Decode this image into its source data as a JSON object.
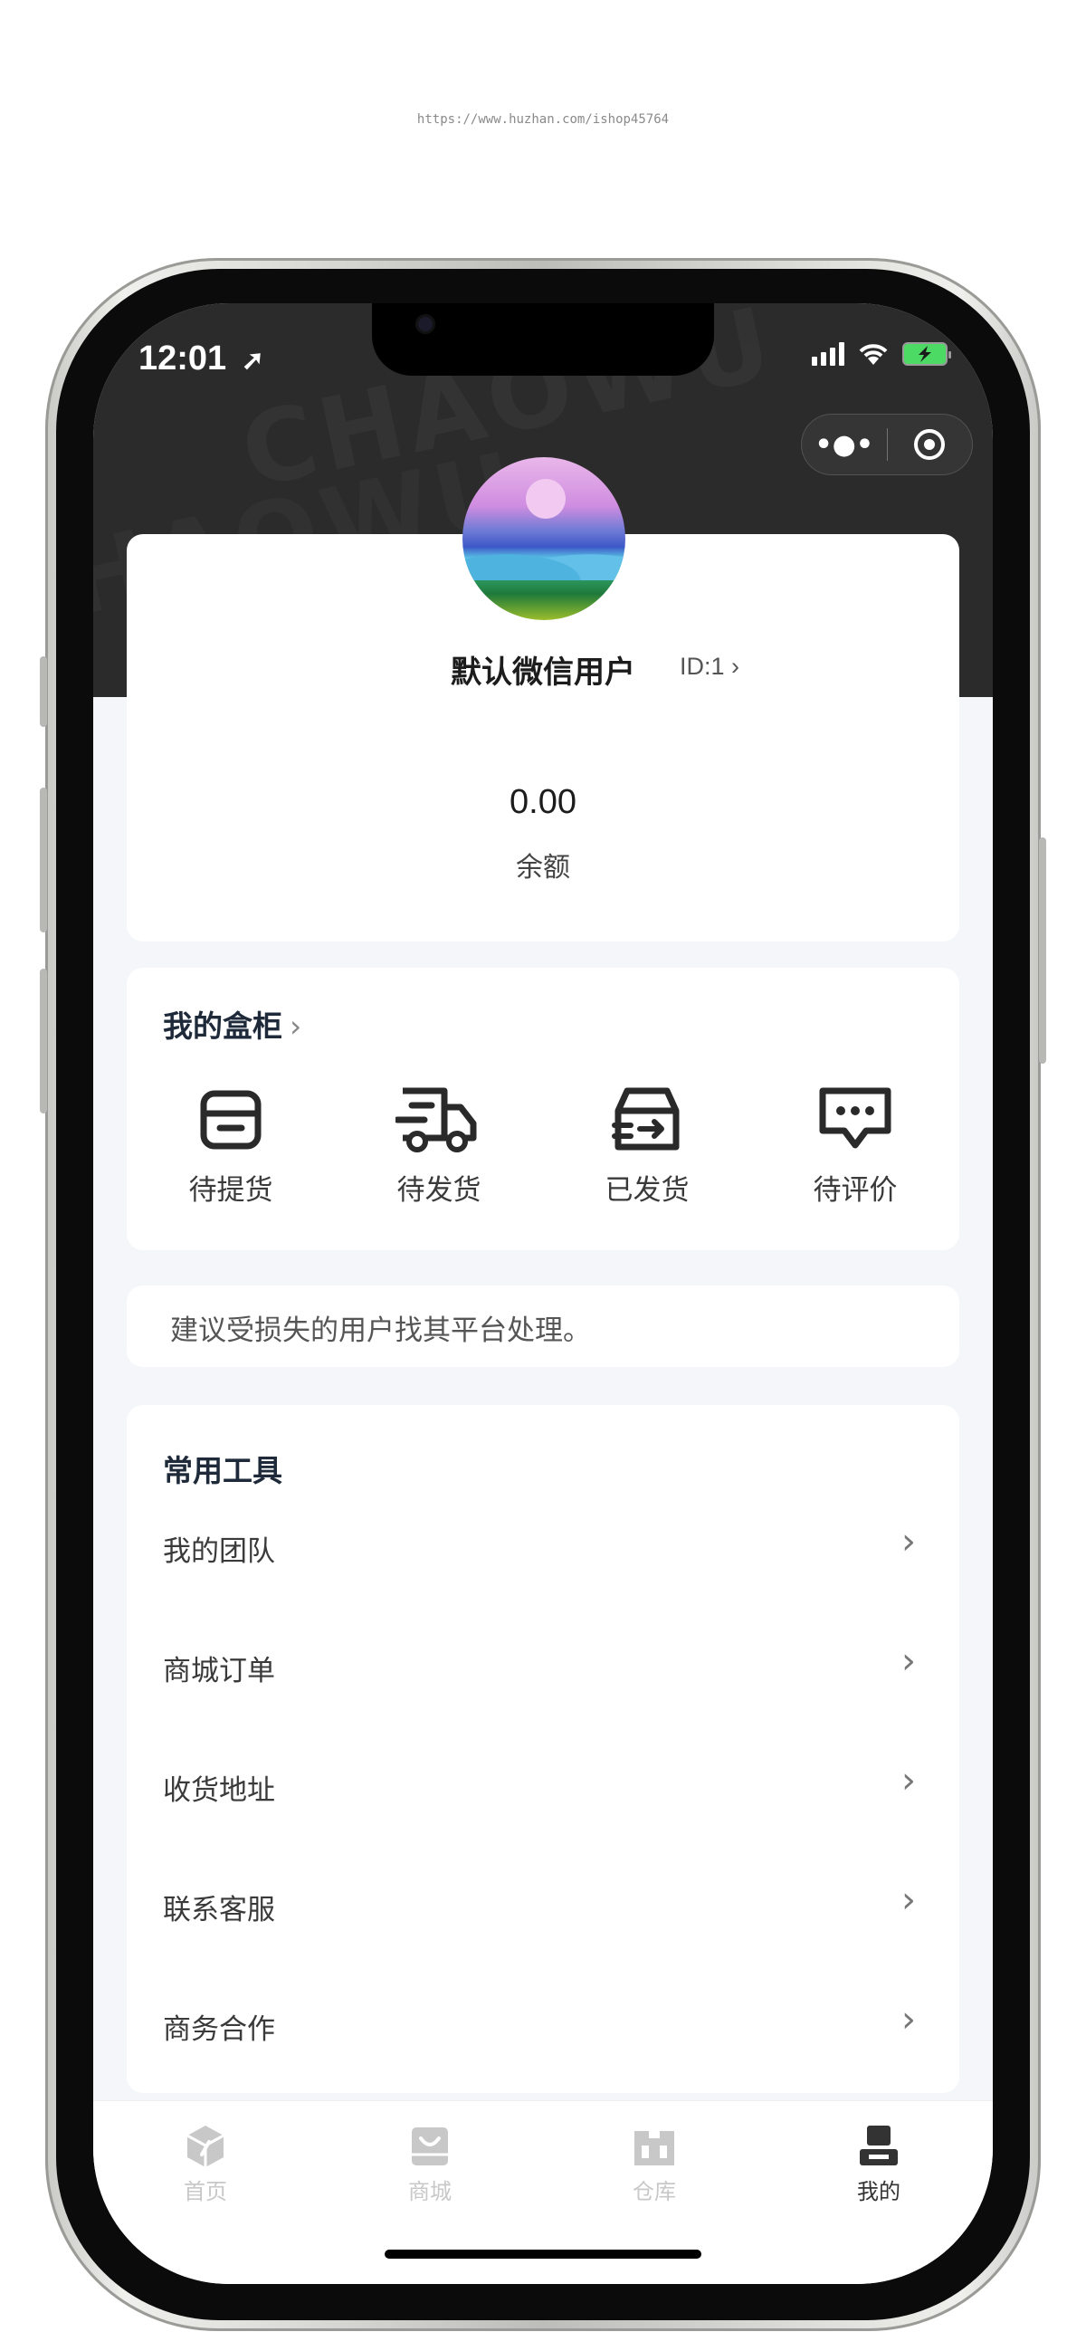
{
  "watermark_url": "https://www.huzhan.com/ishop45764",
  "status_bar": {
    "time": "12:01"
  },
  "header_watermark": "CHAOWU",
  "capsule": {
    "more_icon": "ellipsis-icon",
    "close_icon": "target-icon"
  },
  "profile": {
    "username": "默认微信用户",
    "user_id": "ID:1",
    "balance_value": "0.00",
    "balance_label": "余额"
  },
  "cabinet": {
    "title": "我的盒柜",
    "items": [
      {
        "label": "待提货",
        "icon": "box-icon"
      },
      {
        "label": "待发货",
        "icon": "truck-icon"
      },
      {
        "label": "已发货",
        "icon": "shipped-box-icon"
      },
      {
        "label": "待评价",
        "icon": "comment-icon"
      }
    ]
  },
  "notice": {
    "text": "建议受损失的用户找其平台处理。"
  },
  "tools": {
    "title": "常用工具",
    "items": [
      {
        "label": "我的团队"
      },
      {
        "label": "商城订单"
      },
      {
        "label": "收货地址"
      },
      {
        "label": "联系客服"
      },
      {
        "label": "商务合作"
      }
    ]
  },
  "tabbar": {
    "items": [
      {
        "label": "首页",
        "icon": "home-cube-icon",
        "active": false
      },
      {
        "label": "商城",
        "icon": "shop-bag-icon",
        "active": false
      },
      {
        "label": "仓库",
        "icon": "warehouse-icon",
        "active": false
      },
      {
        "label": "我的",
        "icon": "user-icon",
        "active": true
      }
    ]
  },
  "colors": {
    "header_bg": "#2b2b2b",
    "page_bg": "#f4f6f9",
    "card_bg": "#ffffff",
    "active_tab": "#333333",
    "inactive_tab": "#c8c8c8"
  }
}
